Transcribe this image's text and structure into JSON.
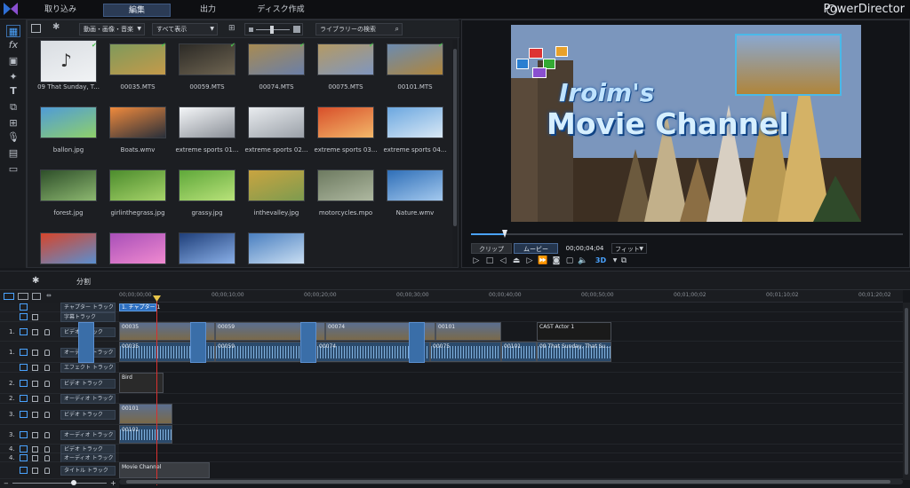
{
  "topbar": {
    "tabs": [
      "取り込み",
      "編集",
      "出力",
      "ディスク作成"
    ],
    "active_tab": "編集",
    "brand": "PowerDirector"
  },
  "library": {
    "type_filter": "動画・画像・音楽",
    "view_filter": "すべて表示",
    "search_placeholder": "ライブラリーの検索",
    "items": [
      {
        "label": "09 That Sunday, T...",
        "kind": "music"
      },
      {
        "label": "00035.MTS"
      },
      {
        "label": "00059.MTS"
      },
      {
        "label": "00074.MTS"
      },
      {
        "label": "00075.MTS"
      },
      {
        "label": "00101.MTS"
      },
      {
        "label": "ballon.jpg"
      },
      {
        "label": "Boats.wmv"
      },
      {
        "label": "extreme sports 01..."
      },
      {
        "label": "extreme sports 02..."
      },
      {
        "label": "extreme sports 03..."
      },
      {
        "label": "extreme sports 04..."
      },
      {
        "label": "forest.jpg"
      },
      {
        "label": "girlinthegrass.jpg"
      },
      {
        "label": "grassy.jpg"
      },
      {
        "label": "inthevalley.jpg"
      },
      {
        "label": "motorcycles.mpo"
      },
      {
        "label": "Nature.wmv"
      },
      {
        "label": ""
      },
      {
        "label": ""
      },
      {
        "label": ""
      },
      {
        "label": ""
      }
    ]
  },
  "preview": {
    "title_line1": "Iroim's",
    "title_line2": "Movie Channel",
    "clip_button": "クリップ",
    "movie_button": "ムービー",
    "timecode": "00;00;04;04",
    "fit_label": "フィット",
    "threed_label": "3D"
  },
  "timeline_toolbar": {
    "split_label": "分割"
  },
  "ruler": {
    "ticks": [
      "00;00;00;00",
      "00;00;10;00",
      "00;00;20;00",
      "00;00;30;00",
      "00;00;40;00",
      "00;00;50;00",
      "00;01;00;02",
      "00;01;10;02",
      "00;01;20;02"
    ]
  },
  "tracks": {
    "chapter": "チャプター トラック",
    "subtitle": "字幕トラック",
    "video1": "ビデオ トラック",
    "audio1": "オーディオ トラック",
    "effect": "エフェクト トラック",
    "video2": "ビデオ トラック",
    "audio2": "オーディオ トラック",
    "video3": "ビデオ トラック",
    "audio3": "オーディオ トラック",
    "video4": "ビデオ トラック",
    "audio4": "オーディオ トラック",
    "title": "タイトル トラック",
    "n1": "1.",
    "n2": "2.",
    "n3": "3.",
    "n4": "4."
  },
  "clips": {
    "chapter_marker": "1. チャプター 1",
    "v1": [
      "00035",
      "00059",
      "00074",
      "00101",
      "CAST  Actor 1"
    ],
    "a1": [
      "00035",
      "00059",
      "00074",
      "00075",
      "00101",
      "09 That Sunday, That Su..."
    ],
    "v2": "Bird",
    "v3": "00101",
    "a3": "00101",
    "title_clip": "Movie Channel"
  }
}
